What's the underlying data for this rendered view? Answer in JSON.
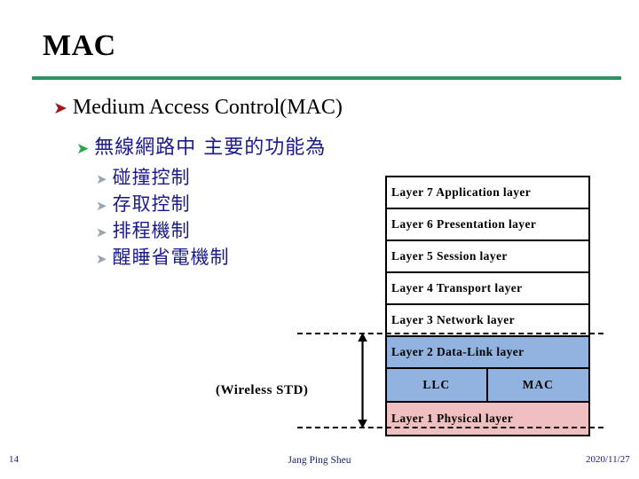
{
  "slide": {
    "title": "MAC",
    "accent_color": "#2e9362",
    "page_number": "14",
    "author": "Jang Ping Sheu",
    "date": "2020/11/27"
  },
  "bullets": {
    "level1": {
      "marker": "arrowhead-bullet-icon",
      "glyph": "➤",
      "text": "Medium Access Control(MAC)",
      "color": "#9e1b1b"
    },
    "level2": {
      "marker": "arrowhead-bullet-icon",
      "glyph": "➤",
      "text": "無線網路中 主要的功能為",
      "color": "#22a94c"
    },
    "level3": [
      {
        "glyph": "➤",
        "text": "碰撞控制"
      },
      {
        "glyph": "➤",
        "text": "存取控制"
      },
      {
        "glyph": "➤",
        "text": "排程機制"
      },
      {
        "glyph": "➤",
        "text": "醒睡省電機制"
      }
    ]
  },
  "osi_stack": {
    "rows": [
      {
        "label": "Layer 7  Application layer",
        "fill": "#ffffff"
      },
      {
        "label": "Layer 6  Presentation layer",
        "fill": "#ffffff"
      },
      {
        "label": "Layer 5  Session layer",
        "fill": "#ffffff"
      },
      {
        "label": "Layer 4  Transport layer",
        "fill": "#ffffff"
      },
      {
        "label": "Layer 3  Network layer",
        "fill": "#ffffff"
      },
      {
        "label": "Layer 2  Data-Link layer",
        "fill": "#92b3e0"
      }
    ],
    "sublayers": {
      "left": "LLC",
      "right": "MAC",
      "fill": "#92b3e0"
    },
    "physical": {
      "label": "Layer 1  Physical layer",
      "fill": "#f0bfbf"
    }
  },
  "annotation": {
    "span_label": "(Wireless  STD)",
    "arrow": "double-headed-vertical-arrow-icon"
  }
}
